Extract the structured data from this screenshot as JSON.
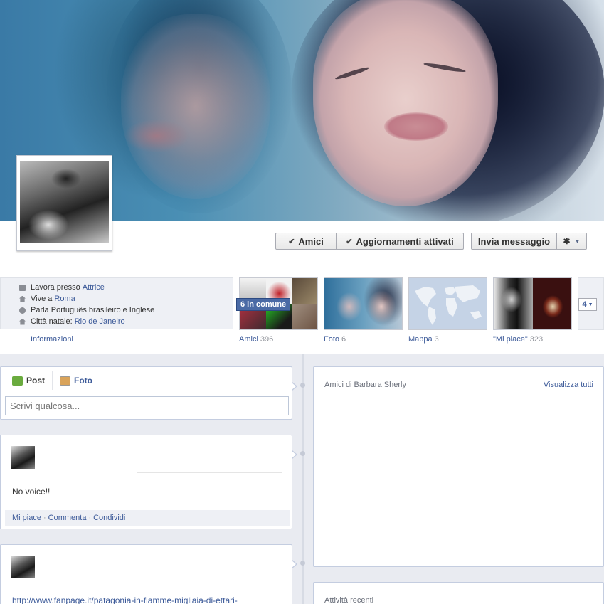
{
  "header": {
    "buttons": {
      "friends": "Amici",
      "updates": "Aggiornamenti attivati",
      "message": "Invia messaggio"
    }
  },
  "info": {
    "works_prefix": "Lavora presso",
    "works_value": "Attrice",
    "lives_prefix": "Vive a",
    "lives_value": "Roma",
    "languages": "Parla Português brasileiro e Inglese",
    "hometown_prefix": "Città natale:",
    "hometown_value": "Rio de Janeiro",
    "link": "Informazioni"
  },
  "tiles": {
    "friends_label": "Amici",
    "friends_count": "396",
    "friends_common": "6 in comune",
    "photos_label": "Foto",
    "photos_count": "6",
    "map_label": "Mappa",
    "map_count": "3",
    "likes_label": "\"Mi piace\"",
    "likes_count": "323",
    "more_count": "4"
  },
  "composer": {
    "tab_post": "Post",
    "tab_photo": "Foto",
    "placeholder": "Scrivi qualcosa..."
  },
  "posts": [
    {
      "text": "No voice!!",
      "actions": [
        "Mi piace",
        "Commenta",
        "Condividi"
      ]
    },
    {
      "link": "http://www.fanpage.it/patagonia-in-fiamme-migliaia-di-ettari-"
    }
  ],
  "sidebar": {
    "friends_title": "Amici di Barbara Sherly",
    "view_all": "Visualizza tutti",
    "recent_title": "Attività recenti"
  },
  "icons": {
    "briefcase": "briefcase-icon",
    "home": "home-icon",
    "globe": "globe-icon",
    "hometown": "house-icon",
    "gear": "gear-icon",
    "checkmark": "check-icon"
  },
  "colors": {
    "link": "#3b5998",
    "background": "#e9ebf1",
    "badge": "#4a6aa5"
  }
}
